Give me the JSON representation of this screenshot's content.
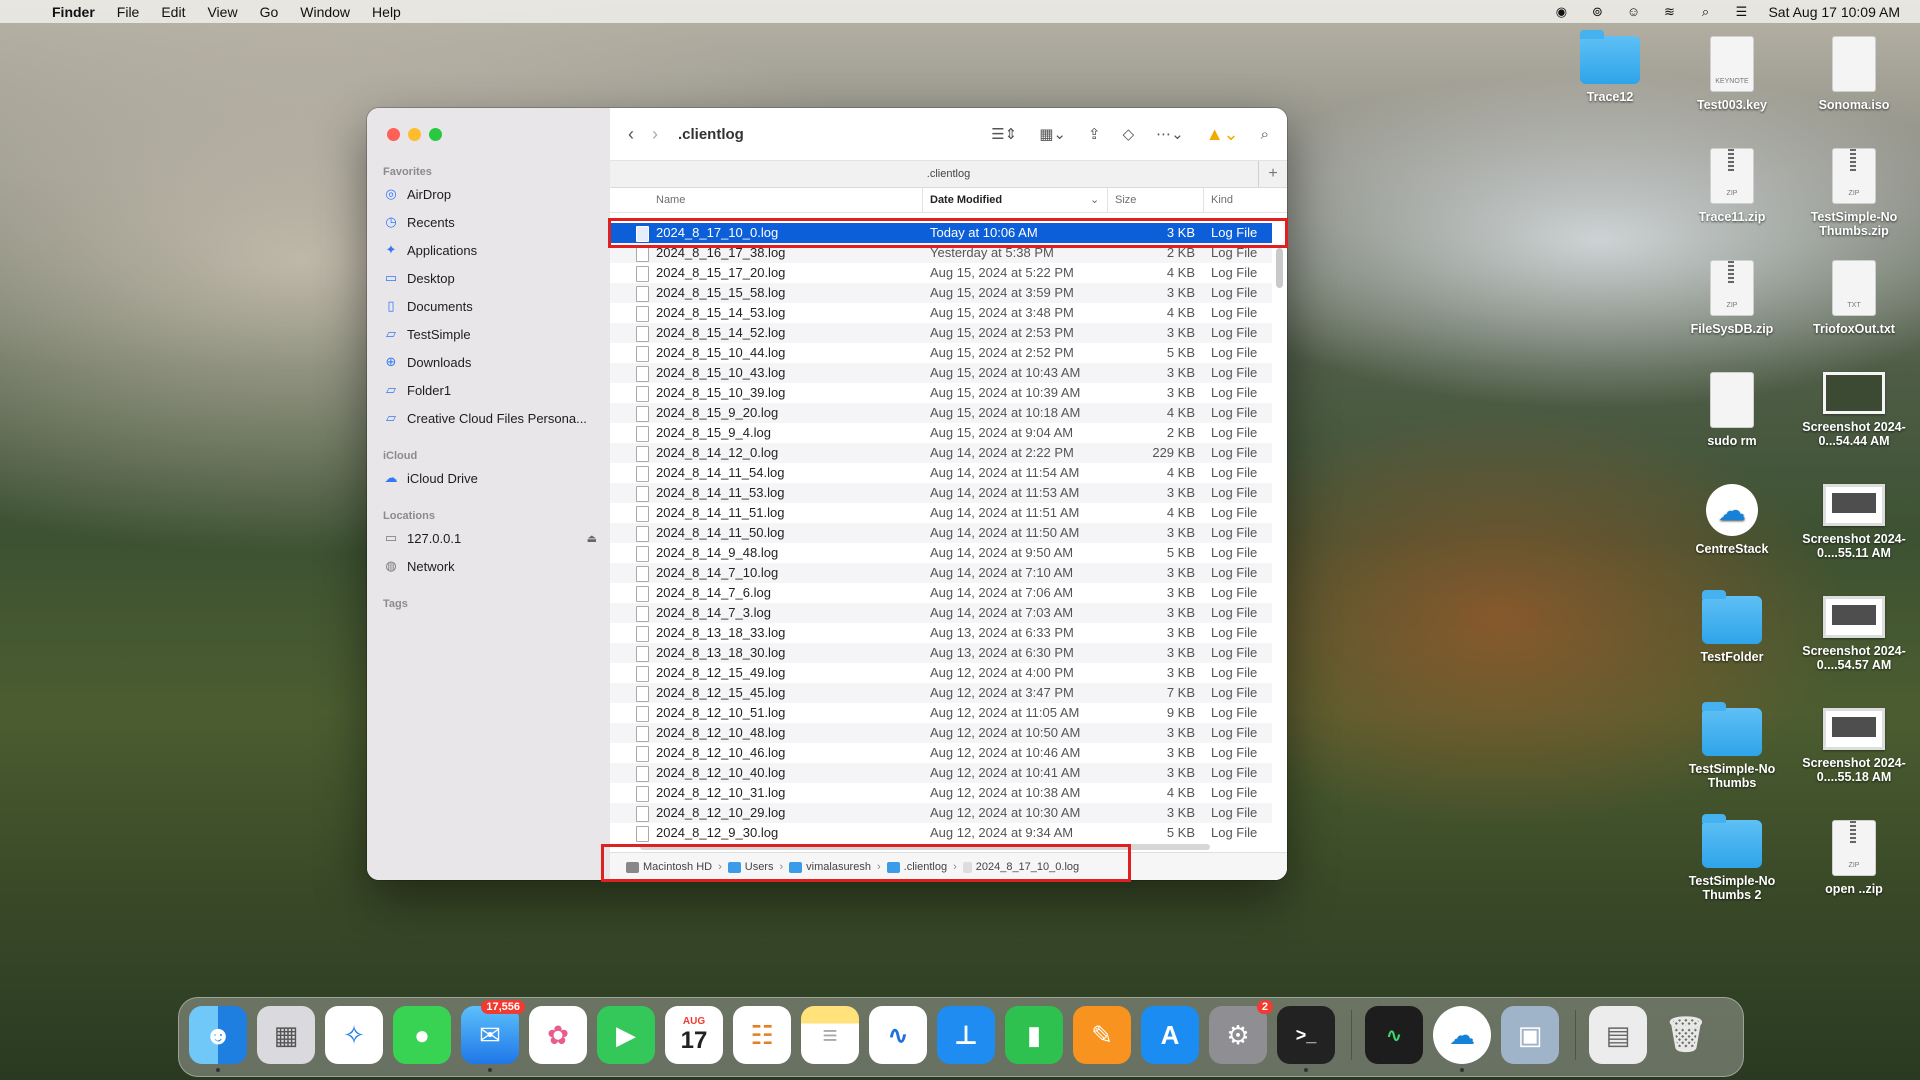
{
  "menubar": {
    "app": "Finder",
    "items": [
      "File",
      "Edit",
      "View",
      "Go",
      "Window",
      "Help"
    ],
    "clock": "Sat Aug 17  10:09 AM"
  },
  "desktop_icons": [
    {
      "label": "Trace12",
      "type": "folder"
    },
    {
      "label": "Test003.key",
      "type": "keynote"
    },
    {
      "label": "Sonoma.iso",
      "type": "disk"
    },
    {
      "label": "Trace11.zip",
      "type": "zip"
    },
    {
      "label": "TestSimple-No Thumbs.zip",
      "type": "zip"
    },
    {
      "label": "FileSysDB.zip",
      "type": "zip"
    },
    {
      "label": "TriofoxOut.txt",
      "type": "txt"
    },
    {
      "label": "sudo rm",
      "type": "doc"
    },
    {
      "label": "Screenshot 2024-0...54.44 AM",
      "type": "screenshot"
    },
    {
      "label": "CentreStack",
      "type": "app"
    },
    {
      "label": "Screenshot 2024-0....55.11 AM",
      "type": "screenshot"
    },
    {
      "label": "TestFolder",
      "type": "folder"
    },
    {
      "label": "Screenshot 2024-0....54.57 AM",
      "type": "screenshot"
    },
    {
      "label": "TestSimple-No Thumbs",
      "type": "folder"
    },
    {
      "label": "Screenshot 2024-0....55.18 AM",
      "type": "screenshot"
    },
    {
      "label": "TestSimple-No Thumbs 2",
      "type": "folder"
    },
    {
      "label": "open ..zip",
      "type": "zip"
    }
  ],
  "finder": {
    "sidebar": {
      "favorites_title": "Favorites",
      "favorites": [
        "AirDrop",
        "Recents",
        "Applications",
        "Desktop",
        "Documents",
        "TestSimple",
        "Downloads",
        "Folder1",
        "Creative Cloud Files Persona..."
      ],
      "icloud_title": "iCloud",
      "icloud": [
        "iCloud Drive"
      ],
      "locations_title": "Locations",
      "locations": [
        "127.0.0.1",
        "Network"
      ],
      "tags_title": "Tags"
    },
    "toolbar": {
      "title": ".clientlog"
    },
    "tab_title": ".clientlog",
    "columns": {
      "name": "Name",
      "date": "Date Modified",
      "size": "Size",
      "kind": "Kind"
    },
    "files": [
      {
        "name": "2024_8_17_10_0.log",
        "date": "Today at 10:06 AM",
        "size": "3 KB",
        "kind": "Log File",
        "selected": true
      },
      {
        "name": "2024_8_16_17_38.log",
        "date": "Yesterday at 5:38 PM",
        "size": "2 KB",
        "kind": "Log File"
      },
      {
        "name": "2024_8_15_17_20.log",
        "date": "Aug 15, 2024 at 5:22 PM",
        "size": "4 KB",
        "kind": "Log File"
      },
      {
        "name": "2024_8_15_15_58.log",
        "date": "Aug 15, 2024 at 3:59 PM",
        "size": "3 KB",
        "kind": "Log File"
      },
      {
        "name": "2024_8_15_14_53.log",
        "date": "Aug 15, 2024 at 3:48 PM",
        "size": "4 KB",
        "kind": "Log File"
      },
      {
        "name": "2024_8_15_14_52.log",
        "date": "Aug 15, 2024 at 2:53 PM",
        "size": "3 KB",
        "kind": "Log File"
      },
      {
        "name": "2024_8_15_10_44.log",
        "date": "Aug 15, 2024 at 2:52 PM",
        "size": "5 KB",
        "kind": "Log File"
      },
      {
        "name": "2024_8_15_10_43.log",
        "date": "Aug 15, 2024 at 10:43 AM",
        "size": "3 KB",
        "kind": "Log File"
      },
      {
        "name": "2024_8_15_10_39.log",
        "date": "Aug 15, 2024 at 10:39 AM",
        "size": "3 KB",
        "kind": "Log File"
      },
      {
        "name": "2024_8_15_9_20.log",
        "date": "Aug 15, 2024 at 10:18 AM",
        "size": "4 KB",
        "kind": "Log File"
      },
      {
        "name": "2024_8_15_9_4.log",
        "date": "Aug 15, 2024 at 9:04 AM",
        "size": "2 KB",
        "kind": "Log File"
      },
      {
        "name": "2024_8_14_12_0.log",
        "date": "Aug 14, 2024 at 2:22 PM",
        "size": "229 KB",
        "kind": "Log File"
      },
      {
        "name": "2024_8_14_11_54.log",
        "date": "Aug 14, 2024 at 11:54 AM",
        "size": "4 KB",
        "kind": "Log File"
      },
      {
        "name": "2024_8_14_11_53.log",
        "date": "Aug 14, 2024 at 11:53 AM",
        "size": "3 KB",
        "kind": "Log File"
      },
      {
        "name": "2024_8_14_11_51.log",
        "date": "Aug 14, 2024 at 11:51 AM",
        "size": "4 KB",
        "kind": "Log File"
      },
      {
        "name": "2024_8_14_11_50.log",
        "date": "Aug 14, 2024 at 11:50 AM",
        "size": "3 KB",
        "kind": "Log File"
      },
      {
        "name": "2024_8_14_9_48.log",
        "date": "Aug 14, 2024 at 9:50 AM",
        "size": "5 KB",
        "kind": "Log File"
      },
      {
        "name": "2024_8_14_7_10.log",
        "date": "Aug 14, 2024 at 7:10 AM",
        "size": "3 KB",
        "kind": "Log File"
      },
      {
        "name": "2024_8_14_7_6.log",
        "date": "Aug 14, 2024 at 7:06 AM",
        "size": "3 KB",
        "kind": "Log File"
      },
      {
        "name": "2024_8_14_7_3.log",
        "date": "Aug 14, 2024 at 7:03 AM",
        "size": "3 KB",
        "kind": "Log File"
      },
      {
        "name": "2024_8_13_18_33.log",
        "date": "Aug 13, 2024 at 6:33 PM",
        "size": "3 KB",
        "kind": "Log File"
      },
      {
        "name": "2024_8_13_18_30.log",
        "date": "Aug 13, 2024 at 6:30 PM",
        "size": "3 KB",
        "kind": "Log File"
      },
      {
        "name": "2024_8_12_15_49.log",
        "date": "Aug 12, 2024 at 4:00 PM",
        "size": "3 KB",
        "kind": "Log File"
      },
      {
        "name": "2024_8_12_15_45.log",
        "date": "Aug 12, 2024 at 3:47 PM",
        "size": "7 KB",
        "kind": "Log File"
      },
      {
        "name": "2024_8_12_10_51.log",
        "date": "Aug 12, 2024 at 11:05 AM",
        "size": "9 KB",
        "kind": "Log File"
      },
      {
        "name": "2024_8_12_10_48.log",
        "date": "Aug 12, 2024 at 10:50 AM",
        "size": "3 KB",
        "kind": "Log File"
      },
      {
        "name": "2024_8_12_10_46.log",
        "date": "Aug 12, 2024 at 10:46 AM",
        "size": "3 KB",
        "kind": "Log File"
      },
      {
        "name": "2024_8_12_10_40.log",
        "date": "Aug 12, 2024 at 10:41 AM",
        "size": "3 KB",
        "kind": "Log File"
      },
      {
        "name": "2024_8_12_10_31.log",
        "date": "Aug 12, 2024 at 10:38 AM",
        "size": "4 KB",
        "kind": "Log File"
      },
      {
        "name": "2024_8_12_10_29.log",
        "date": "Aug 12, 2024 at 10:30 AM",
        "size": "3 KB",
        "kind": "Log File"
      },
      {
        "name": "2024_8_12_9_30.log",
        "date": "Aug 12, 2024 at 9:34 AM",
        "size": "5 KB",
        "kind": "Log File"
      }
    ],
    "pathbar": [
      "Macintosh HD",
      "Users",
      "vimalasuresh",
      ".clientlog",
      "2024_8_17_10_0.log"
    ]
  },
  "dock": {
    "mail_badge": "17,556",
    "settings_badge": "2",
    "calendar_month": "AUG",
    "calendar_day": "17"
  }
}
